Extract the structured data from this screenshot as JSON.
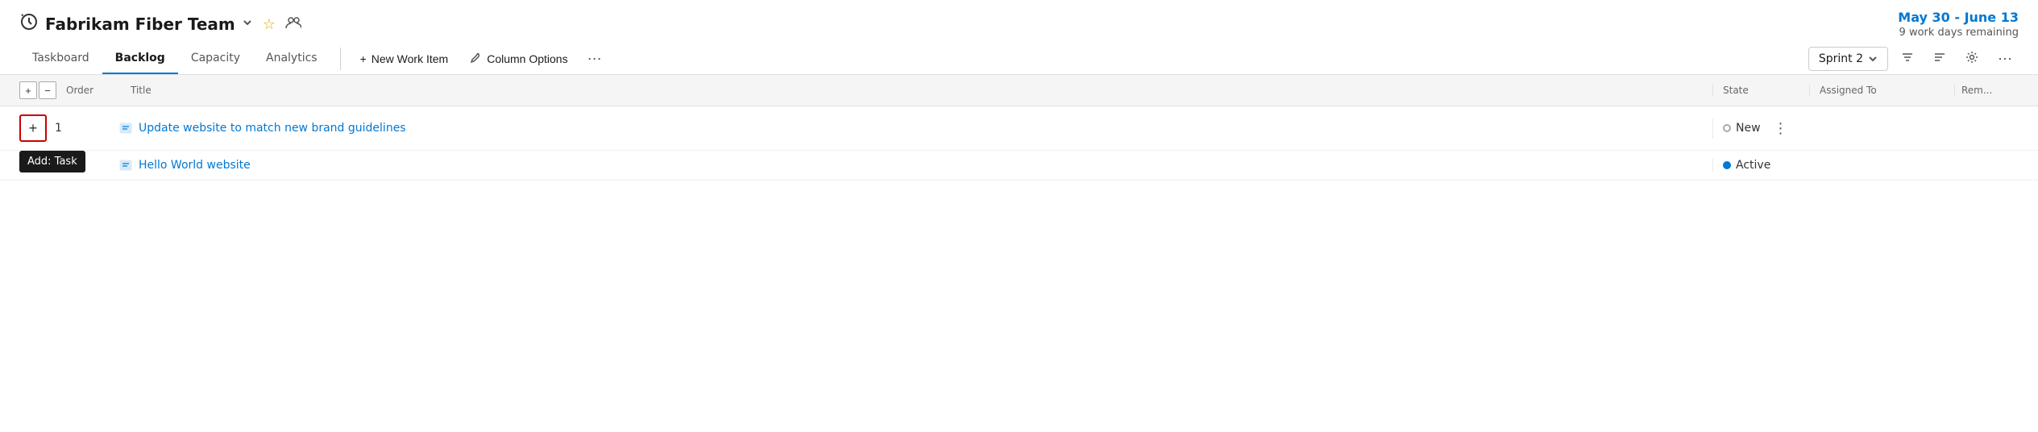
{
  "header": {
    "team_icon": "⏱",
    "team_name": "Fabrikam Fiber Team",
    "chevron": "∨",
    "star_icon": "★",
    "team_settings_icon": "⚙",
    "sprint_date": "May 30 - June 13",
    "work_days": "9 work days remaining"
  },
  "nav": {
    "tabs": [
      {
        "label": "Taskboard",
        "active": false
      },
      {
        "label": "Backlog",
        "active": true
      },
      {
        "label": "Capacity",
        "active": false
      },
      {
        "label": "Analytics",
        "active": false
      }
    ],
    "new_work_item_label": "New Work Item",
    "column_options_label": "Column Options",
    "more_label": "⋯"
  },
  "toolbar": {
    "sprint_label": "Sprint 2",
    "filter_icon": "⚙",
    "view_icon": "≡",
    "settings_icon": "⚙",
    "more_label": "⋯"
  },
  "table": {
    "columns": {
      "expand": "",
      "order": "Order",
      "title": "Title",
      "state": "State",
      "assigned_to": "Assigned To",
      "remaining": "Rem..."
    },
    "rows": [
      {
        "order": "1",
        "title": "Update website to match new brand guidelines",
        "state": "New",
        "state_type": "new",
        "assigned_to": "",
        "remaining": ""
      },
      {
        "order": "",
        "title": "Hello World website",
        "state": "Active",
        "state_type": "active",
        "assigned_to": "",
        "remaining": ""
      }
    ]
  },
  "tooltip": {
    "label": "Add: Task"
  },
  "icons": {
    "plus": "+",
    "minus": "−",
    "wrench": "🔧",
    "chevron_down": "∨",
    "more_vert": "⋮",
    "filter": "⚙",
    "view": "≡",
    "settings": "⚙",
    "work_item_book": "📋"
  }
}
